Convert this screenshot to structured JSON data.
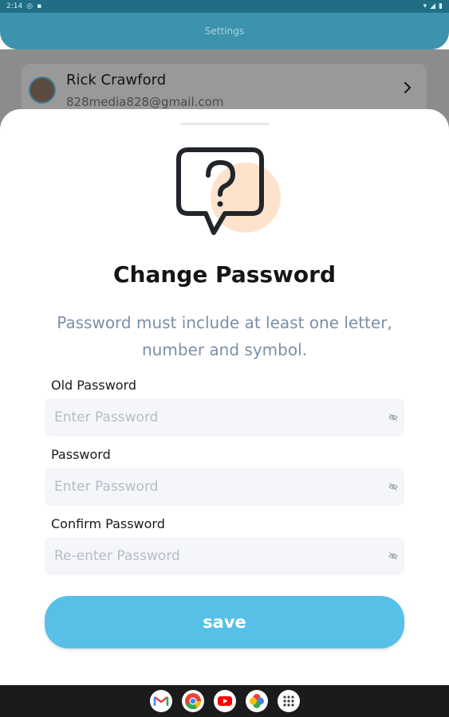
{
  "status_bar": {
    "time": "2:14"
  },
  "header": {
    "title": "Settings"
  },
  "profile": {
    "name": "Rick Crawford",
    "email": "828media828@gmail.com"
  },
  "dialog": {
    "title": "Change Password",
    "description": "Password must include at least one letter, number and symbol.",
    "fields": [
      {
        "label": "Old Password",
        "placeholder": "Enter Password"
      },
      {
        "label": "Password",
        "placeholder": "Enter Password"
      },
      {
        "label": "Confirm Password",
        "placeholder": "Re-enter Password"
      }
    ],
    "save_label": "save"
  },
  "colors": {
    "header": "#3d93ad",
    "save_button": "#57c0e6",
    "accent_circle": "#fde3cc",
    "description_text": "#7b8fa8"
  },
  "taskbar": {
    "apps": [
      "gmail-icon",
      "chrome-icon",
      "youtube-icon",
      "photos-icon",
      "app-drawer-icon"
    ]
  }
}
